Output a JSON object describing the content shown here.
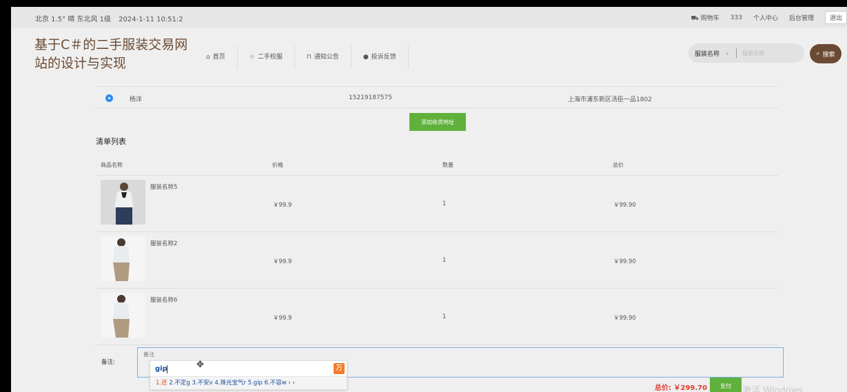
{
  "topbar": {
    "weather": "北京 1.5° 晴 东北风 1级",
    "datetime": "2024-1-11 10:51:2",
    "cart": "购物车",
    "username": "333",
    "personal_center": "个人中心",
    "admin": "后台管理",
    "logout": "退出"
  },
  "site_title": "基于C＃的二手服装交易网站的设计与实现",
  "nav": [
    {
      "label": "首页",
      "icon": "home-icon"
    },
    {
      "label": "二手校服",
      "icon": "star-icon"
    },
    {
      "label": "通知公告",
      "icon": "lock-icon"
    },
    {
      "label": "投诉反馈",
      "icon": "info-icon"
    }
  ],
  "search": {
    "select_value": "服装名称",
    "placeholder": "服装名称",
    "button": "搜索"
  },
  "address": {
    "name": "杨洋",
    "phone": "15219187575",
    "address": "上海市浦东新区汤臣一品1802",
    "add_button": "添加收货地址"
  },
  "list": {
    "title": "清单列表",
    "headers": {
      "name": "商品名称",
      "price": "价格",
      "qty": "数量",
      "total": "总价"
    },
    "items": [
      {
        "name": "服装名称5",
        "price": "￥99.9",
        "qty": "1",
        "total": "￥99.90"
      },
      {
        "name": "服装名称2",
        "price": "￥99.9",
        "qty": "1",
        "total": "￥99.90"
      },
      {
        "name": "服装名称6",
        "price": "￥99.9",
        "qty": "1",
        "total": "￥99.90"
      }
    ]
  },
  "remark": {
    "label": "备注:",
    "placeholder": "备注"
  },
  "ime": {
    "composition": "gip",
    "candidates_first": "1.还",
    "candidates_rest": " 2.不定g 3.不安v 4.珠光宝气r 5.gip 6.不容w ‹ ›"
  },
  "total_label": "总价: ￥299.70",
  "pay_button": "支付",
  "watermark": "激活 Windows",
  "colors": {
    "brand": "#6b4a33",
    "green": "#5fb13c",
    "price_red": "#e03a2c",
    "radio_blue": "#2d8cf0"
  }
}
